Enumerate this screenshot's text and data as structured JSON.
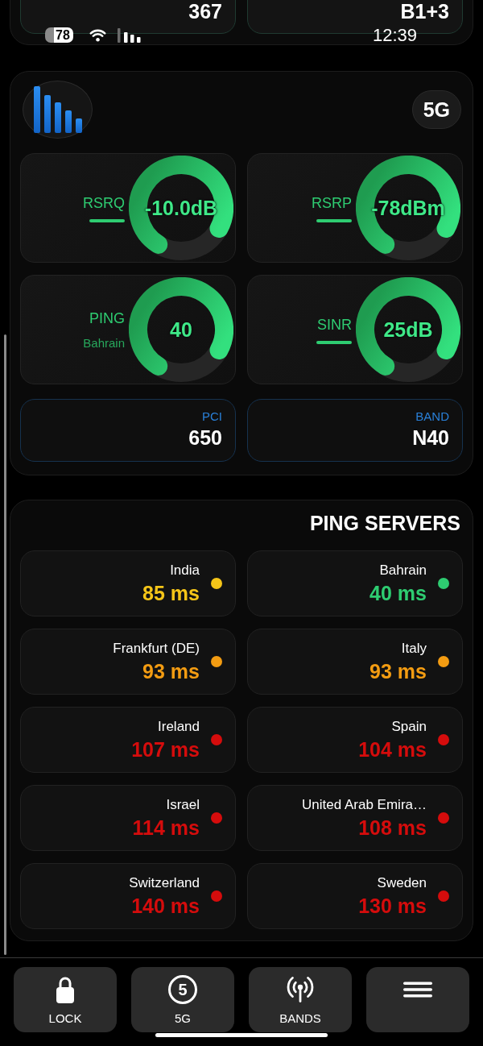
{
  "top_card": {
    "tiles": [
      {
        "value": "367"
      },
      {
        "value": "B1+3"
      }
    ]
  },
  "status_bar": {
    "battery": "78",
    "time": "12:39"
  },
  "signal_card": {
    "network_badge": "5G",
    "gauges": [
      {
        "label": "RSRQ",
        "value": "-10.0dB"
      },
      {
        "label": "RSRP",
        "value": "-78dBm"
      },
      {
        "label": "PING",
        "subtitle": "Bahrain",
        "value": "40"
      },
      {
        "label": "SINR",
        "value": "25dB"
      }
    ],
    "info_tiles": [
      {
        "label": "PCI",
        "value": "650"
      },
      {
        "label": "BAND",
        "value": "N40"
      }
    ]
  },
  "ping_servers": {
    "title": "PING SERVERS",
    "servers": [
      {
        "name": "India",
        "latency": "85 ms",
        "color": "#f5c518"
      },
      {
        "name": "Bahrain",
        "latency": "40 ms",
        "color": "#2ecc71"
      },
      {
        "name": "Frankfurt (DE)",
        "latency": "93 ms",
        "color": "#f39c12"
      },
      {
        "name": "Italy",
        "latency": "93 ms",
        "color": "#f39c12"
      },
      {
        "name": "Ireland",
        "latency": "107 ms",
        "color": "#d50c0c"
      },
      {
        "name": "Spain",
        "latency": "104 ms",
        "color": "#d50c0c"
      },
      {
        "name": "Israel",
        "latency": "114 ms",
        "color": "#d50c0c"
      },
      {
        "name": "United Arab Emira…",
        "latency": "108 ms",
        "color": "#d50c0c"
      },
      {
        "name": "Switzerland",
        "latency": "140 ms",
        "color": "#d50c0c"
      },
      {
        "name": "Sweden",
        "latency": "130 ms",
        "color": "#d50c0c"
      }
    ]
  },
  "toolbar": {
    "buttons": [
      {
        "kind": "lock",
        "label": "LOCK"
      },
      {
        "kind": "circled",
        "icon_text": "5",
        "label": "5G"
      },
      {
        "kind": "antenna",
        "label": "BANDS"
      },
      {
        "kind": "menu"
      }
    ]
  }
}
